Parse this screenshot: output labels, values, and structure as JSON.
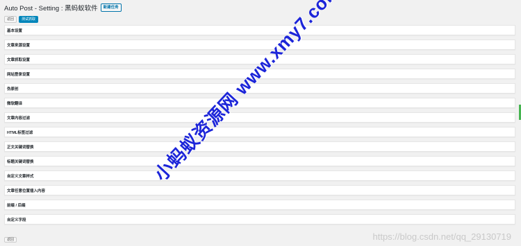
{
  "header": {
    "title": "Auto Post - Setting : 黑蚂蚁软件",
    "add_task_label": "新建任务"
  },
  "actions": {
    "back_label": "返回",
    "test_fetch_label": "测试抓取"
  },
  "sections": [
    {
      "label": "基本设置"
    },
    {
      "label": "文章来源设置"
    },
    {
      "label": "文章抓取设置"
    },
    {
      "label": "网站登录设置"
    },
    {
      "label": "伪原创"
    },
    {
      "label": "微软翻译"
    },
    {
      "label": "文章内容过滤"
    },
    {
      "label": "HTML标签过滤"
    },
    {
      "label": "正文关键词替换"
    },
    {
      "label": "标题关键词替换"
    },
    {
      "label": "自定义文章样式"
    },
    {
      "label": "文章任意位置插入内容"
    },
    {
      "label": "前缀 / 后缀"
    },
    {
      "label": "自定义字段"
    }
  ],
  "footer": {
    "back_label": "返回"
  },
  "watermark": {
    "text": "小蚂蚁资源网 www.xmy7.com",
    "color": "#1c25d9"
  },
  "url_watermark": "https://blog.csdn.net/qq_29130719",
  "colors": {
    "primary": "#0085ba",
    "link": "#0073aa",
    "scroll_indicator": "#46b450",
    "background": "#f1f1f1"
  }
}
